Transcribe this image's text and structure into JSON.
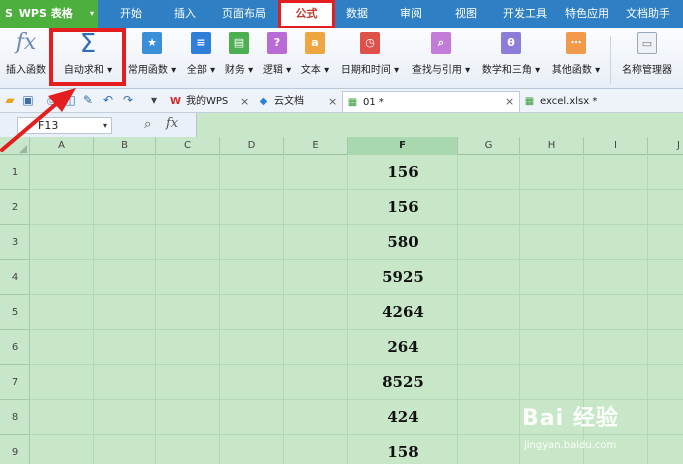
{
  "menubar": {
    "app_logo": "S",
    "app_name": "WPS 表格",
    "tabs": [
      {
        "label": "开始"
      },
      {
        "label": "插入"
      },
      {
        "label": "页面布局"
      },
      {
        "label": "公式",
        "active": true
      },
      {
        "label": "数据"
      },
      {
        "label": "审阅"
      },
      {
        "label": "视图"
      },
      {
        "label": "开发工具"
      },
      {
        "label": "特色应用"
      },
      {
        "label": "文档助手"
      }
    ]
  },
  "ribbon": {
    "items": [
      {
        "label": "插入函数",
        "icon": "fx-icon"
      },
      {
        "label": "自动求和 ▾",
        "icon": "sigma-icon"
      },
      {
        "label": "常用函数 ▾",
        "icon": "star-book-icon"
      },
      {
        "label": "全部 ▾",
        "icon": "list-book-icon"
      },
      {
        "label": "财务 ▾",
        "icon": "finance-book-icon"
      },
      {
        "label": "逻辑 ▾",
        "icon": "logic-book-icon"
      },
      {
        "label": "文本 ▾",
        "icon": "text-book-icon"
      },
      {
        "label": "日期和时间 ▾",
        "icon": "clock-book-icon"
      },
      {
        "label": "查找与引用 ▾",
        "icon": "search-book-icon"
      },
      {
        "label": "数学和三角 ▾",
        "icon": "math-book-icon"
      },
      {
        "label": "其他函数 ▾",
        "icon": "other-book-icon"
      },
      {
        "label": "名称管理器",
        "icon": "name-manager-icon"
      }
    ],
    "icon_glyphs": {
      "star": "★",
      "list": "≡",
      "finance": "▤",
      "logic": "?",
      "text": "a",
      "clock": "◷",
      "search": "⌕",
      "math": "θ",
      "other": "⋯",
      "name": "▭"
    }
  },
  "toolbar": {
    "tabs": [
      {
        "label": "我的WPS",
        "icon": "W"
      },
      {
        "label": "云文档",
        "icon": "◆"
      },
      {
        "label": "01 *",
        "icon": "▦"
      },
      {
        "label": "excel.xlsx *",
        "icon": "▦"
      }
    ],
    "close": "×"
  },
  "formulabar": {
    "cell_ref": "F13",
    "fx": "fx",
    "formula_value": ""
  },
  "sheet": {
    "columns": [
      "A",
      "B",
      "C",
      "D",
      "E",
      "F",
      "G",
      "H",
      "I",
      "J"
    ],
    "rows": [
      "1",
      "2",
      "3",
      "4",
      "5",
      "6",
      "7",
      "8",
      "9"
    ],
    "column_f_values": [
      "156",
      "156",
      "580",
      "5925",
      "4264",
      "264",
      "8525",
      "424",
      "158"
    ]
  },
  "watermark": {
    "brand": "Bai 经验",
    "url": "jingyan.baidu.com"
  },
  "colors": {
    "menubar": "#2e7fc4",
    "app_button": "#4caf3e",
    "sheet_bg": "#c8e7c8",
    "highlight": "#e41e1e"
  }
}
